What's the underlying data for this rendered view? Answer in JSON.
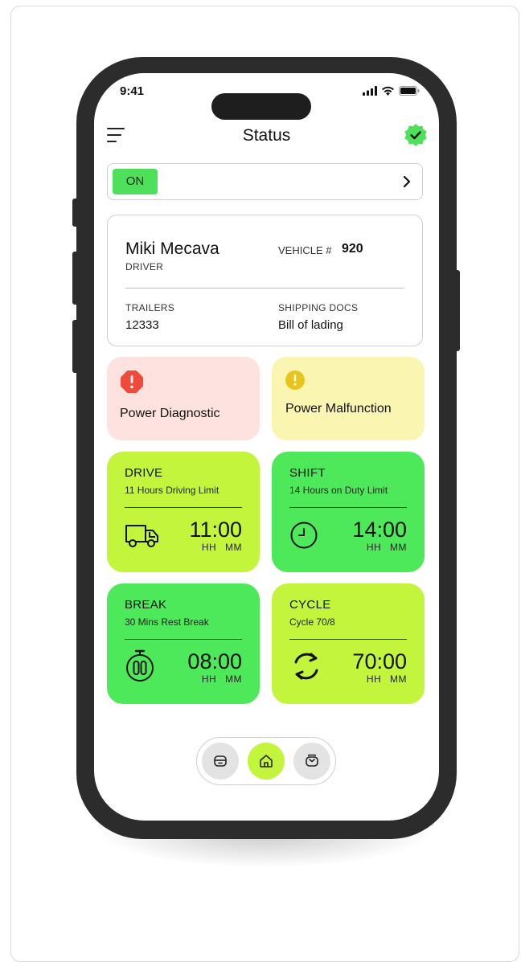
{
  "status_bar": {
    "time": "9:41"
  },
  "header": {
    "title": "Status"
  },
  "duty_status": {
    "label": "ON"
  },
  "driver": {
    "name": "Miki Mecava",
    "role": "DRIVER",
    "vehicle_label": "VEHICLE #",
    "vehicle_number": "920",
    "trailers_label": "TRAILERS",
    "trailers_value": "12333",
    "shipping_docs_label": "SHIPPING DOCS",
    "shipping_docs_value": "Bill of lading"
  },
  "alerts": [
    {
      "title": "Power Diagnostic",
      "color": "#fde2df",
      "icon_color": "#f04a3c"
    },
    {
      "title": "Power Malfunction",
      "color": "#fbf5b2",
      "icon_color": "#e8c51c"
    }
  ],
  "hos": {
    "drive": {
      "title": "DRIVE",
      "subtitle": "11 Hours Driving Limit",
      "time": "11:00",
      "units": "HH MM",
      "color": "#c3f53c"
    },
    "shift": {
      "title": "SHIFT",
      "subtitle": "14 Hours on Duty Limit",
      "time": "14:00",
      "units": "HH MM",
      "color": "#4ee95a"
    },
    "break": {
      "title": "BREAK",
      "subtitle": "30 Mins Rest Break",
      "time": "08:00",
      "units": "HH MM",
      "color": "#4ee95a"
    },
    "cycle": {
      "title": "CYCLE",
      "subtitle": "Cycle 70/8",
      "time": "70:00",
      "units": "HH MM",
      "color": "#c3f53c"
    }
  },
  "bottom_nav": {
    "items": [
      {
        "icon": "inbox-icon",
        "active": false
      },
      {
        "icon": "home-icon",
        "active": true
      },
      {
        "icon": "mail-icon",
        "active": false
      }
    ]
  },
  "colors": {
    "accent_green": "#4ee05a",
    "lime": "#c3f53c",
    "phone_body": "#2c2c2c"
  }
}
